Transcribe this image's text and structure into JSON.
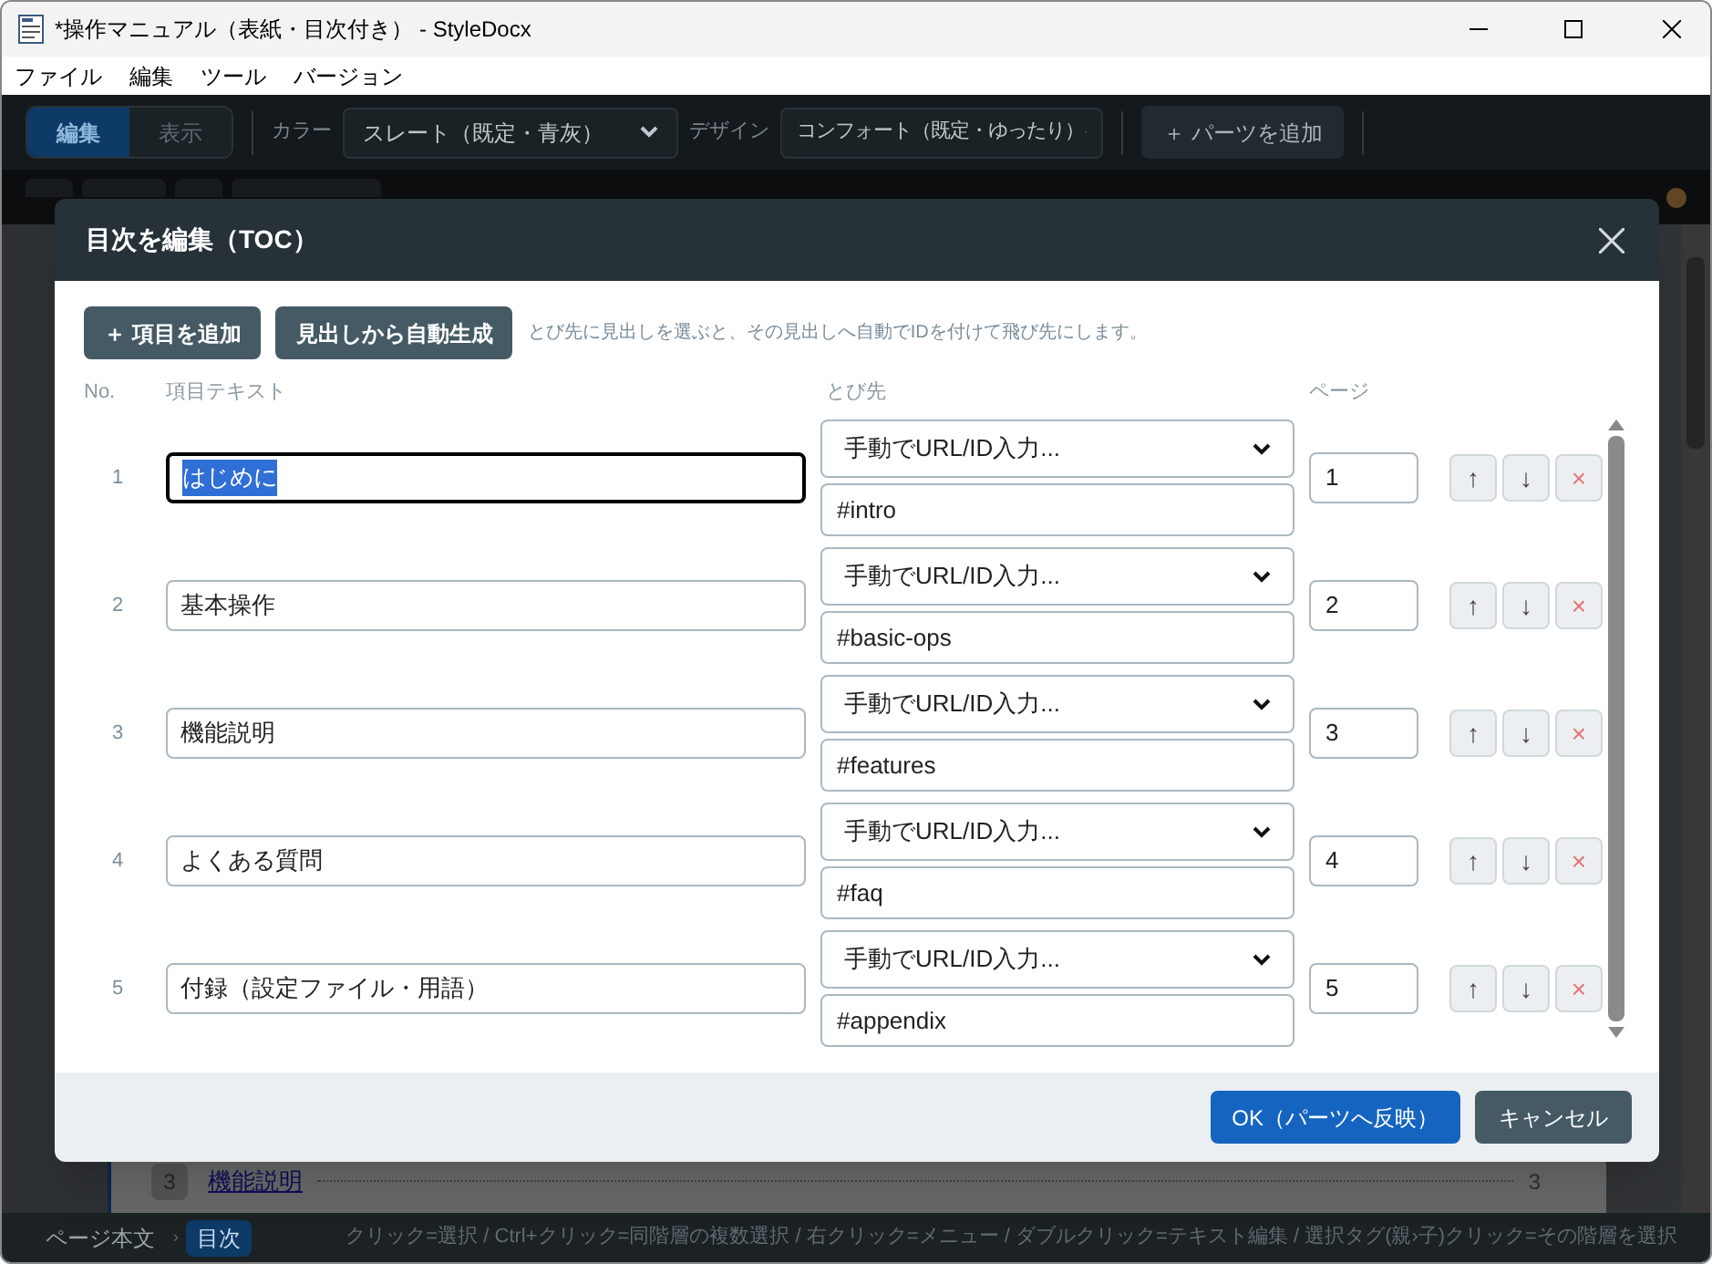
{
  "window": {
    "title": "*操作マニュアル（表紙・目次付き） - StyleDocx"
  },
  "menu": [
    "ファイル",
    "編集",
    "ツール",
    "バージョン"
  ],
  "toolbar": {
    "modes": [
      {
        "label": "編集",
        "selected": true
      },
      {
        "label": "表示",
        "selected": false
      }
    ],
    "color_label": "カラー",
    "color_value": "スレート（既定・青灰）",
    "design_label": "デザイン",
    "design_value": "コンフォート（既定・ゆったり）",
    "add_part": "＋ パーツを追加"
  },
  "page_behind": {
    "number": "3",
    "link": "機能説明",
    "page": "3"
  },
  "dialog": {
    "title": "目次を編集（TOC）",
    "actions": [
      "＋ 項目を追加",
      "見出しから自動生成"
    ],
    "hint": "とび先に見出しを選ぶと、その見出しへ自動でIDを付けて飛び先にします。",
    "columns": [
      "No.",
      "項目テキスト",
      "とび先",
      "ページ"
    ],
    "rows": [
      {
        "no": "1",
        "text": "はじめに",
        "focused": true,
        "target": "手動でURL/ID入力...",
        "url": "#intro",
        "page": "1"
      },
      {
        "no": "2",
        "text": "基本操作",
        "focused": false,
        "target": "手動でURL/ID入力...",
        "url": "#basic-ops",
        "page": "2"
      },
      {
        "no": "3",
        "text": "機能説明",
        "focused": false,
        "target": "手動でURL/ID入力...",
        "url": "#features",
        "page": "3"
      },
      {
        "no": "4",
        "text": "よくある質問",
        "focused": false,
        "target": "手動でURL/ID入力...",
        "url": "#faq",
        "page": "4"
      },
      {
        "no": "5",
        "text": "付録（設定ファイル・用語）",
        "focused": false,
        "target": "手動でURL/ID入力...",
        "url": "#appendix",
        "page": "5"
      }
    ],
    "row_buttons": [
      "↑",
      "↓",
      "×"
    ],
    "ok": "OK（パーツへ反映）",
    "cancel": "キャンセル"
  },
  "status_bar": {
    "breadcrumb": [
      {
        "label": "ページ本文",
        "selected": false
      },
      {
        "label": "目次",
        "selected": true
      }
    ],
    "separator": "›",
    "hint": "クリック=選択 / Ctrl+クリック=同階層の複数選択 / 右クリック=メニュー / ダブルクリック=テキスト編集 / 選択タグ(親›子)クリック=その階層を選択"
  }
}
